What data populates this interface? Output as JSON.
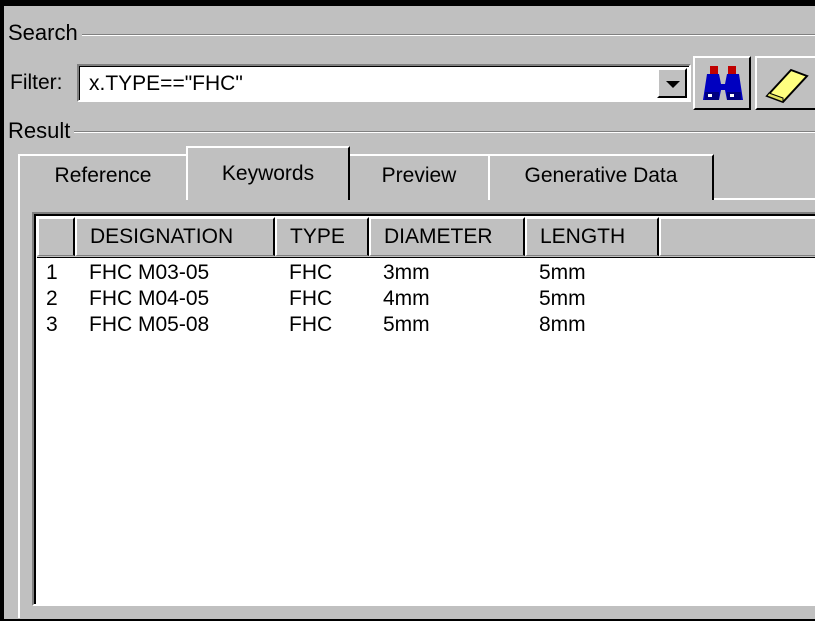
{
  "search": {
    "group_label": "Search",
    "filter_label": "Filter:",
    "filter_value": "x.TYPE==\"FHC\"",
    "dropdown_icon": "chevron-down-icon",
    "find_icon": "binoculars-icon",
    "clear_icon": "eraser-icon"
  },
  "result": {
    "group_label": "Result",
    "tabs": [
      {
        "label": "Reference",
        "active": false
      },
      {
        "label": "Keywords",
        "active": true
      },
      {
        "label": "Preview",
        "active": false
      },
      {
        "label": "Generative Data",
        "active": false
      }
    ],
    "table": {
      "columns": [
        "",
        "DESIGNATION",
        "TYPE",
        "DIAMETER",
        "LENGTH"
      ],
      "rows": [
        {
          "index": "1",
          "designation": "FHC M03-05",
          "type": "FHC",
          "diameter": "3mm",
          "length": "5mm"
        },
        {
          "index": "2",
          "designation": "FHC M04-05",
          "type": "FHC",
          "diameter": "4mm",
          "length": "5mm"
        },
        {
          "index": "3",
          "designation": "FHC M05-08",
          "type": "FHC",
          "diameter": "5mm",
          "length": "8mm"
        }
      ]
    }
  },
  "colors": {
    "window_bg": "#c0c0c0",
    "list_bg": "#ffffff",
    "binoculars_blue": "#0000c0",
    "binoculars_red": "#c00000",
    "eraser_yellow": "#ffff80"
  }
}
